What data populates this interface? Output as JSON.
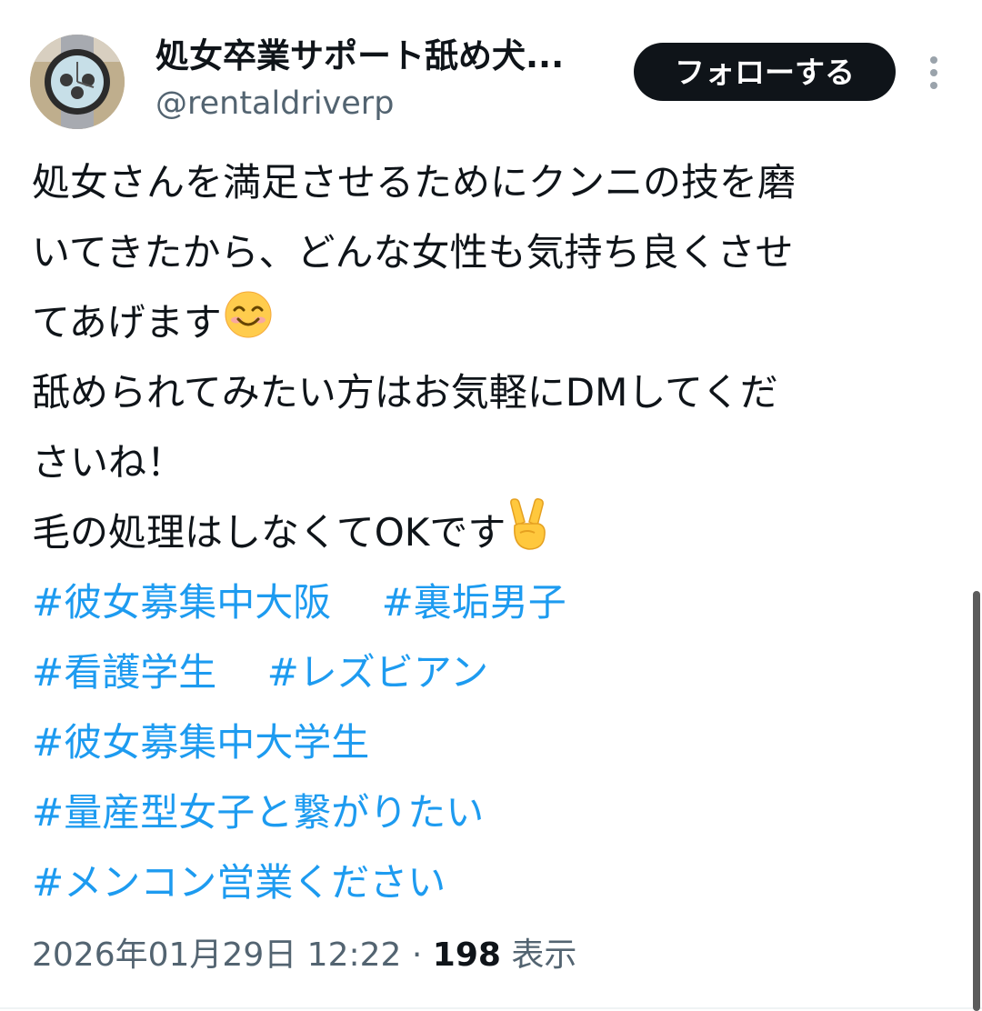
{
  "author": {
    "display_name": "処女卒業サポート舐め犬...",
    "handle": "@rentaldriverp",
    "avatar_icon": "watch-avatar-icon"
  },
  "follow_button": {
    "label": "フォローする"
  },
  "more_icon": "more-vertical-icon",
  "tweet": {
    "lines": [
      "処女さんを満足させるためにクンニの技を磨",
      "いてきたから、どんな女性も気持ち良くさせ",
      "てあげます",
      "舐められてみたい方はお気軽にDMしてくだ",
      "さいね！",
      "毛の処理はしなくてOKです"
    ],
    "emoji_smile": "smiling-face-emoji",
    "emoji_victory": "victory-hand-emoji",
    "hashtags": [
      [
        "#彼女募集中大阪",
        "#裏垢男子"
      ],
      [
        "#看護学生",
        "#レズビアン"
      ],
      [
        "#彼女募集中大学生"
      ],
      [
        "#量産型女子と繋がりたい"
      ],
      [
        "#メンコン営業ください"
      ]
    ]
  },
  "meta": {
    "timestamp": "2026年01月29日 12:22",
    "separator": "·",
    "views_count": "198",
    "views_label": "表示"
  },
  "colors": {
    "hashtag": "#1d9bf0",
    "text": "#0f1419",
    "secondary": "#536471",
    "button_bg": "#0f1419"
  }
}
